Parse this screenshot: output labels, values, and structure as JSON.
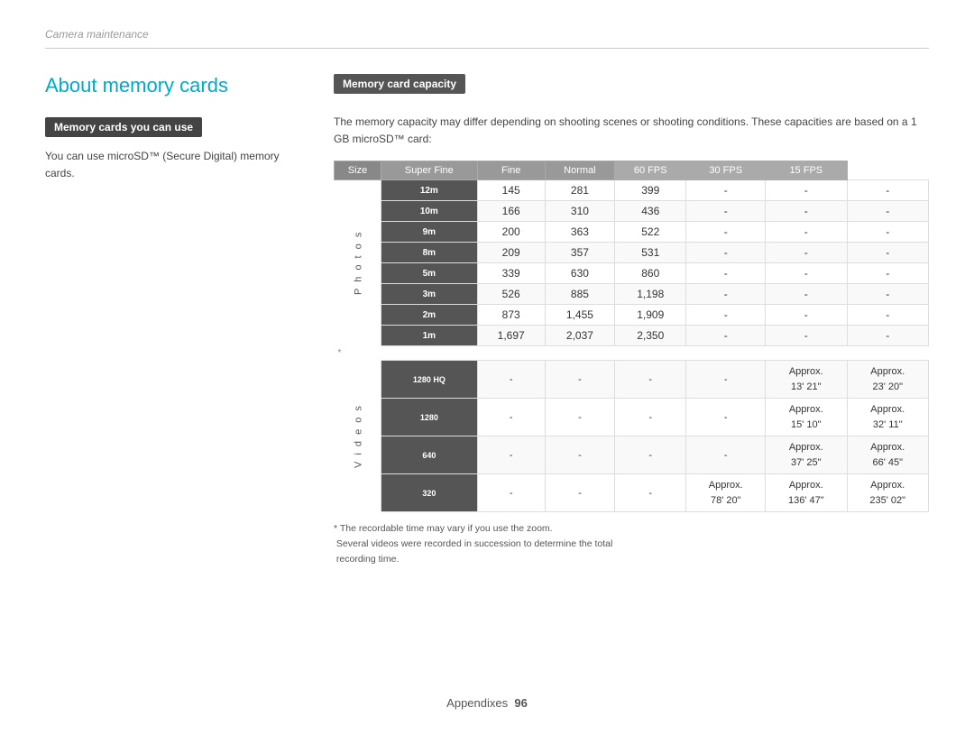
{
  "breadcrumb": "Camera maintenance",
  "mainTitle": "About memory cards",
  "leftSection": {
    "header": "Memory cards you can use",
    "description": "You can use microSD™ (Secure Digital) memory cards."
  },
  "rightSection": {
    "header": "Memory card capacity",
    "intro": "The memory capacity may differ depending on shooting scenes or shooting conditions. These capacities are based on a 1 GB microSD™ card:",
    "tableHeaders": {
      "size": "Size",
      "superFine": "Super Fine",
      "fine": "Fine",
      "normal": "Normal",
      "fps60": "60 FPS",
      "fps30": "30 FPS",
      "fps15": "15 FPS"
    },
    "photosRows": [
      {
        "icon": "12m",
        "superFine": "145",
        "fine": "281",
        "normal": "399",
        "fps60": "-",
        "fps30": "-",
        "fps15": "-"
      },
      {
        "icon": "10m",
        "superFine": "166",
        "fine": "310",
        "normal": "436",
        "fps60": "-",
        "fps30": "-",
        "fps15": "-"
      },
      {
        "icon": "9m",
        "superFine": "200",
        "fine": "363",
        "normal": "522",
        "fps60": "-",
        "fps30": "-",
        "fps15": "-"
      },
      {
        "icon": "8m",
        "superFine": "209",
        "fine": "357",
        "normal": "531",
        "fps60": "-",
        "fps30": "-",
        "fps15": "-"
      },
      {
        "icon": "5m",
        "superFine": "339",
        "fine": "630",
        "normal": "860",
        "fps60": "-",
        "fps30": "-",
        "fps15": "-"
      },
      {
        "icon": "3m",
        "superFine": "526",
        "fine": "885",
        "normal": "1,198",
        "fps60": "-",
        "fps30": "-",
        "fps15": "-"
      },
      {
        "icon": "2m",
        "superFine": "873",
        "fine": "1,455",
        "normal": "1,909",
        "fps60": "-",
        "fps30": "-",
        "fps15": "-"
      },
      {
        "icon": "1m",
        "superFine": "1,697",
        "fine": "2,037",
        "normal": "2,350",
        "fps60": "-",
        "fps30": "-",
        "fps15": "-"
      }
    ],
    "videosRows": [
      {
        "icon": "1280 HQ",
        "superFine": "-",
        "fine": "-",
        "normal": "-",
        "fps60": "-",
        "fps30": "Approx.\n13' 21\"",
        "fps15": "Approx.\n23' 20\""
      },
      {
        "icon": "1280",
        "superFine": "-",
        "fine": "-",
        "normal": "-",
        "fps60": "-",
        "fps30": "Approx.\n15' 10\"",
        "fps15": "Approx.\n32' 11\""
      },
      {
        "icon": "640",
        "superFine": "-",
        "fine": "-",
        "normal": "-",
        "fps60": "-",
        "fps30": "Approx.\n37' 25\"",
        "fps15": "Approx.\n66' 45\""
      },
      {
        "icon": "320",
        "superFine": "-",
        "fine": "-",
        "normal": "-",
        "fps60": "Approx.\n78' 20\"",
        "fps30": "Approx.\n136' 47\"",
        "fps15": "Approx.\n235' 02\""
      }
    ],
    "footnotes": [
      "* The recordable time may vary if you use the zoom.",
      "Several videos were recorded in succession to determine the total recording time."
    ]
  },
  "footer": {
    "label": "Appendixes",
    "page": "96"
  }
}
